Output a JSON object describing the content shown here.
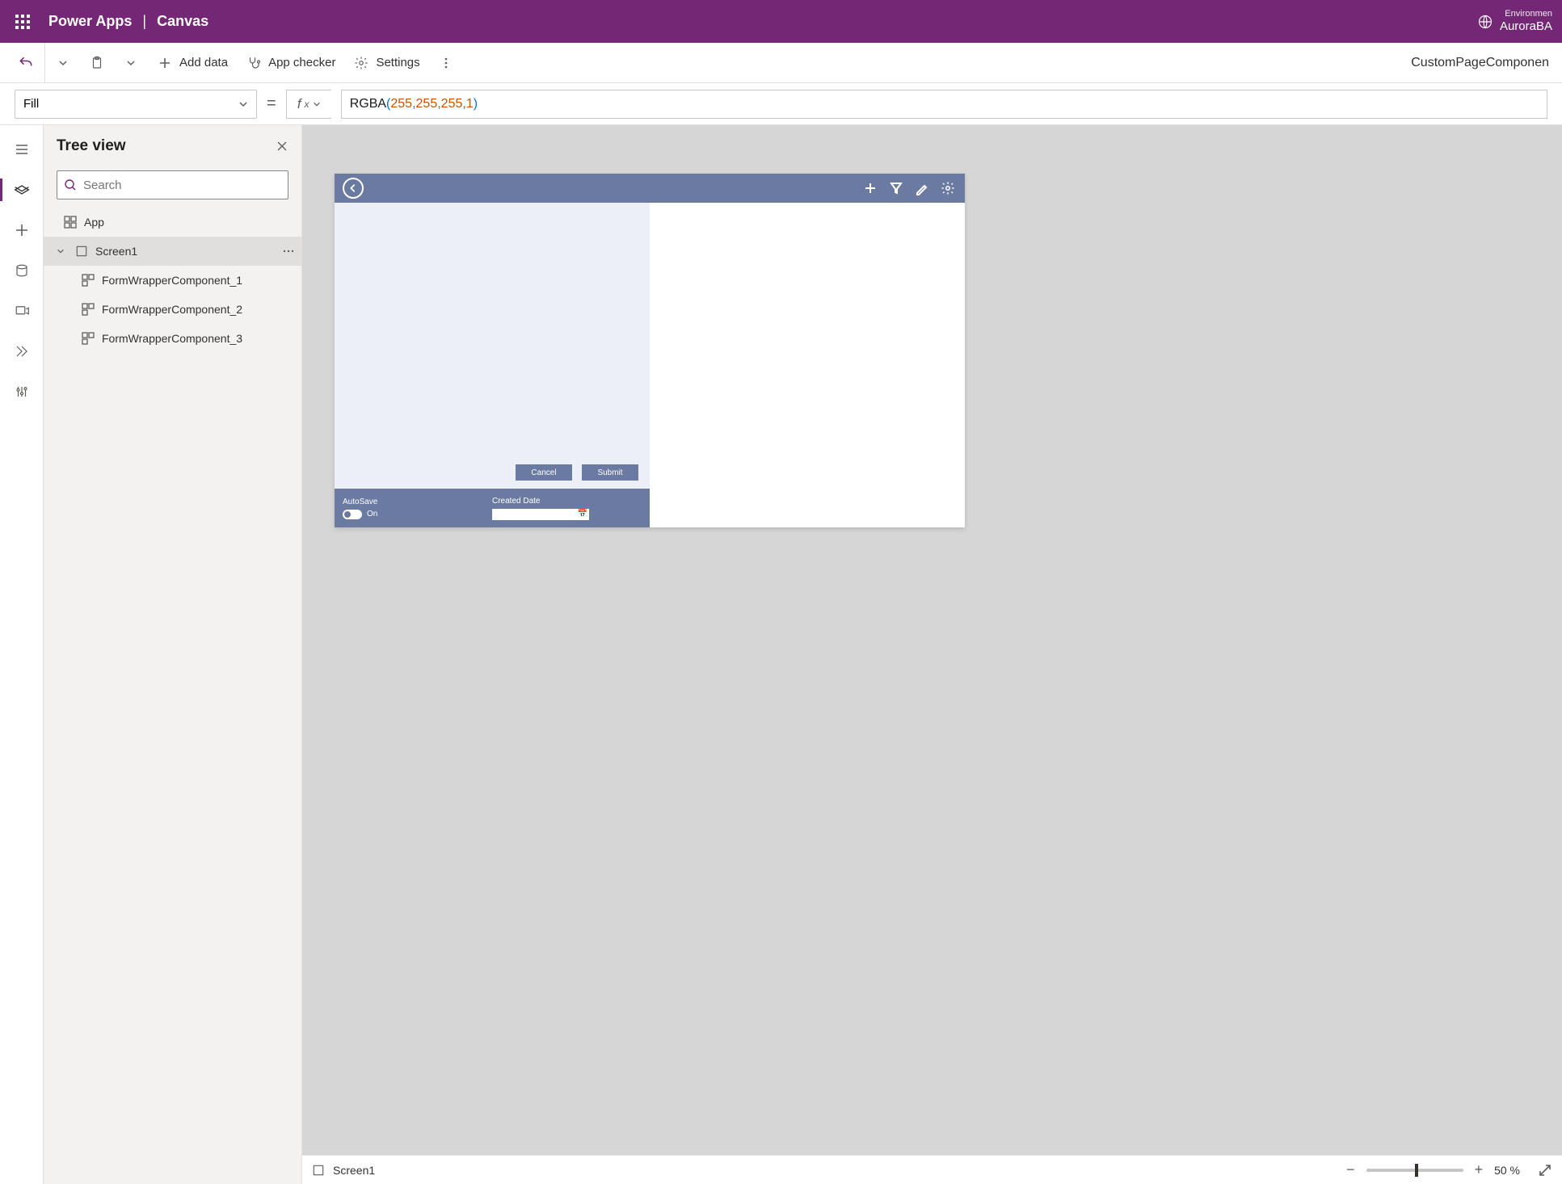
{
  "header": {
    "brand_app": "Power Apps",
    "brand_section": "Canvas",
    "env_label": "Environmen",
    "env_name": "AuroraBA"
  },
  "toolbar": {
    "add_data": "Add data",
    "app_checker": "App checker",
    "settings": "Settings",
    "app_name": "CustomPageComponen"
  },
  "formula": {
    "property": "Fill",
    "fn": "RGBA",
    "args": [
      "255",
      "255",
      "255",
      "1"
    ]
  },
  "tree": {
    "title": "Tree view",
    "search_placeholder": "Search",
    "app_label": "App",
    "screen_label": "Screen1",
    "children": [
      "FormWrapperComponent_1",
      "FormWrapperComponent_2",
      "FormWrapperComponent_3"
    ]
  },
  "canvas": {
    "buttons": {
      "cancel": "Cancel",
      "submit": "Submit"
    },
    "footer": {
      "autosave_label": "AutoSave",
      "autosave_value": "On",
      "created_label": "Created Date"
    }
  },
  "status": {
    "screen": "Screen1",
    "zoom_value": "50",
    "zoom_unit": "%"
  }
}
